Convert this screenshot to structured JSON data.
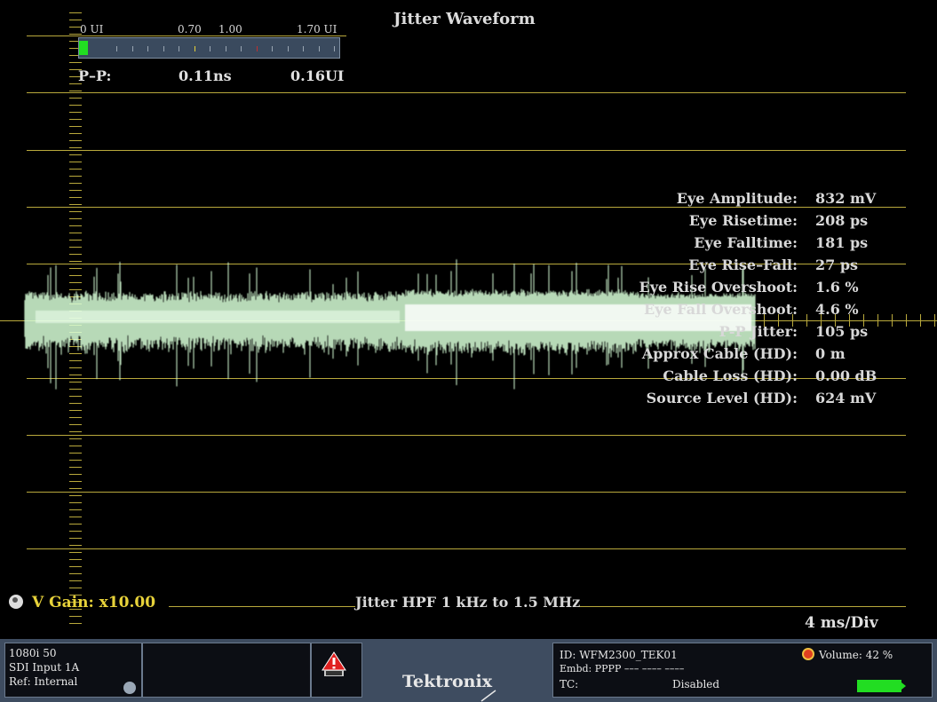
{
  "title": "Jitter Waveform",
  "meter": {
    "label_0": "0 UI",
    "label_070": "0.70",
    "label_100": "1.00",
    "label_170": "1.70 UI",
    "fill_fraction": 0.08,
    "pp_label": "P–P:",
    "pp_ns": "0.11ns",
    "pp_ui": "0.16UI"
  },
  "stats": [
    {
      "label": "Eye Amplitude:",
      "value": "832 mV"
    },
    {
      "label": "Eye Risetime:",
      "value": "208 ps"
    },
    {
      "label": "Eye Falltime:",
      "value": "181 ps"
    },
    {
      "label": "Eye Rise–Fall:",
      "value": "27 ps"
    },
    {
      "label": "Eye Rise Overshoot:",
      "value": "1.6 %"
    },
    {
      "label": "Eye Fall Overshoot:",
      "value": "4.6 %"
    },
    {
      "label": "P-P Jitter:",
      "value": "105 ps"
    },
    {
      "label": "Approx Cable (HD):",
      "value": "0 m"
    },
    {
      "label": "Cable Loss (HD):",
      "value": "0.00 dB"
    },
    {
      "label": "Source Level (HD):",
      "value": "624 mV"
    }
  ],
  "footer": {
    "vgain": "V Gain: x10.00",
    "hpf": "Jitter HPF 1 kHz to 1.5 MHz",
    "timediv": "4 ms/Div"
  },
  "status": {
    "format": "1080i 50",
    "input": "SDI Input 1A",
    "ref": "Ref: Internal",
    "brand": "Tektronix",
    "id": "ID: WFM2300_TEK01",
    "embd": "Embd: PPPP ––– –––– ––––",
    "tc_label": "TC:",
    "tc_value": "Disabled",
    "volume": "Volume:  42 %",
    "volume_level": 0.42
  },
  "colors": {
    "graticule": "#b9a93c",
    "trace": "#d8ffd8",
    "meter_fill": "#22dd22",
    "status_bg": "#3e4c60"
  },
  "icons": [
    "knob-icon",
    "alarm-icon",
    "volume-mute-icon"
  ]
}
